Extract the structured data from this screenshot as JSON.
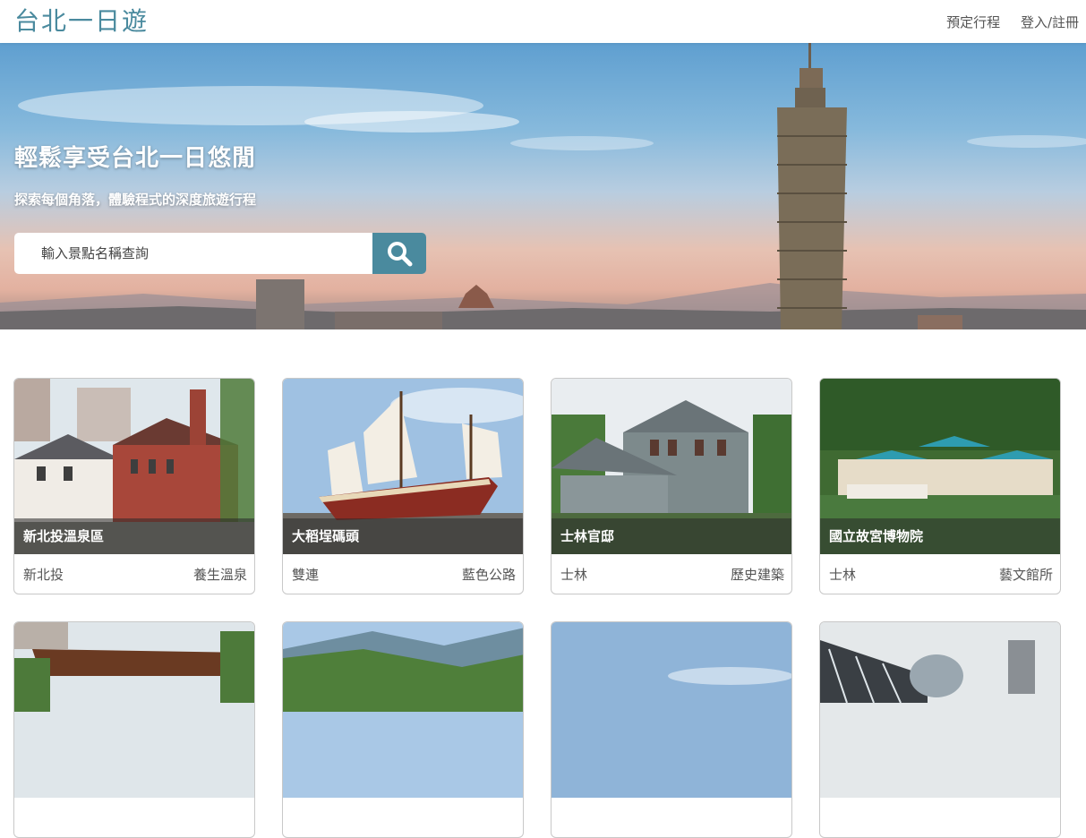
{
  "header": {
    "brand": "台北一日遊",
    "nav": [
      "預定行程",
      "登入/註冊"
    ]
  },
  "hero": {
    "title": "輕鬆享受台北一日悠閒",
    "subtitle": "探索每個角落，體驗程式的深度旅遊行程",
    "search_placeholder": "輸入景點名稱查詢",
    "search_icon": "search-icon"
  },
  "attractions": [
    {
      "name": "新北投溫泉區",
      "district": "新北投",
      "category": "養生溫泉"
    },
    {
      "name": "大稻埕碼頭",
      "district": "雙連",
      "category": "藍色公路"
    },
    {
      "name": "士林官邸",
      "district": "士林",
      "category": "歷史建築"
    },
    {
      "name": "國立故宮博物院",
      "district": "士林",
      "category": "藝文館所"
    }
  ],
  "colors": {
    "accent": "#4a8a9e",
    "caption_bg": "rgba(40,40,40,0.55)"
  }
}
